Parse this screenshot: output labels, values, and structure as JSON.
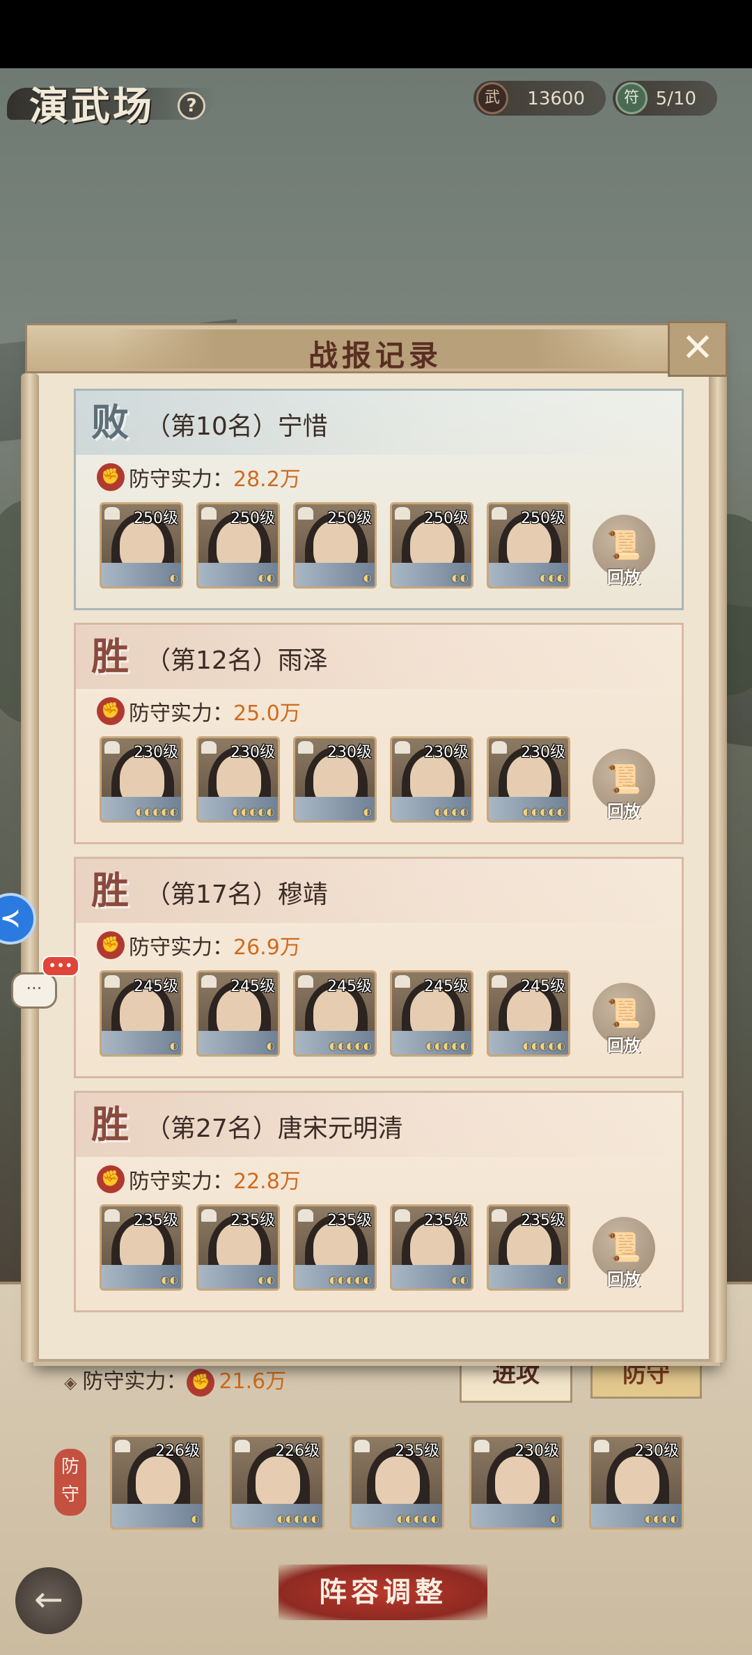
{
  "header": {
    "title": "演武场",
    "help_icon": "?",
    "currency": {
      "icon": "武",
      "value": "13600"
    },
    "tickets": {
      "icon": "符",
      "value": "5/10"
    }
  },
  "panel": {
    "title": "战报记录",
    "close_icon": "✕"
  },
  "records": [
    {
      "result": "败",
      "result_type": "lose",
      "rank_name": "（第10名）宁惜",
      "power_label": "防守实力：",
      "power_value": "28.2万",
      "levels": [
        "250级",
        "250级",
        "250级",
        "250级",
        "250级"
      ],
      "stars": [
        "◐",
        "◐◐",
        "◐",
        "◐◐",
        "◐◐◐"
      ],
      "replay_label": "回放"
    },
    {
      "result": "胜",
      "result_type": "win",
      "rank_name": "（第12名）雨泽",
      "power_label": "防守实力：",
      "power_value": "25.0万",
      "levels": [
        "230级",
        "230级",
        "230级",
        "230级",
        "230级"
      ],
      "stars": [
        "◐◐◐◐◐",
        "◐◐◐◐◐",
        "◐",
        "◐◐◐◐",
        "◐◐◐◐◐"
      ],
      "replay_label": "回放"
    },
    {
      "result": "胜",
      "result_type": "win",
      "rank_name": "（第17名）穆靖",
      "power_label": "防守实力：",
      "power_value": "26.9万",
      "levels": [
        "245级",
        "245级",
        "245级",
        "245级",
        "245级"
      ],
      "stars": [
        "◐",
        "◐",
        "◐◐◐◐◐",
        "◐◐◐◐◐",
        "◐◐◐◐◐"
      ],
      "replay_label": "回放"
    },
    {
      "result": "胜",
      "result_type": "win",
      "rank_name": "（第27名）唐宋元明清",
      "power_label": "防守实力：",
      "power_value": "22.8万",
      "levels": [
        "235级",
        "235级",
        "235级",
        "235级",
        "235级"
      ],
      "stars": [
        "◐◐",
        "◐◐",
        "◐◐◐◐◐",
        "◐◐",
        "◐"
      ],
      "replay_label": "回放"
    }
  ],
  "bottom": {
    "power_icon": "◈",
    "power_label": "防守实力：",
    "power_value": "21.6万",
    "tab_attack": "进攻",
    "tab_defend": "防守",
    "side_label": "防守",
    "my_levels": [
      "226级",
      "226级",
      "235级",
      "230级",
      "230级"
    ],
    "my_stars": [
      "◐",
      "◐◐◐◐◐",
      "◐◐◐◐◐",
      "◐",
      "◐◐◐◐"
    ],
    "lineup_button": "阵容调整",
    "back_icon": "←"
  },
  "assist": {
    "float_icon": "≺",
    "chat_icon": "···"
  }
}
